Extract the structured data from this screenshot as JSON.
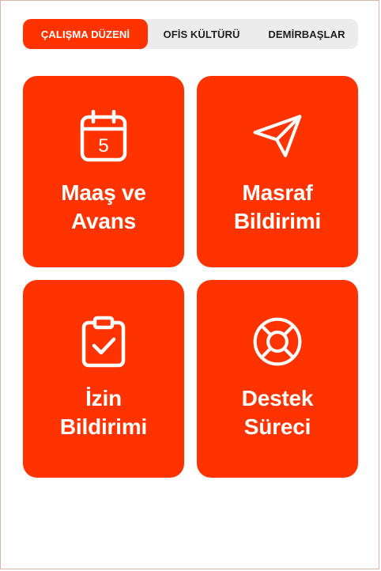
{
  "tabs": [
    {
      "label": "ÇALIŞMA DÜZENİ",
      "active": true
    },
    {
      "label": "OFİS KÜLTÜRÜ",
      "active": false
    },
    {
      "label": "DEMİRBAŞLAR",
      "active": false
    }
  ],
  "cards": [
    {
      "line1": "Maaş ve",
      "line2": "Avans",
      "icon": "calendar-icon",
      "calendar_day": "5"
    },
    {
      "line1": "Masraf",
      "line2": "Bildirimi",
      "icon": "send-icon"
    },
    {
      "line1": "İzin",
      "line2": "Bildirimi",
      "icon": "clipboard-check-icon"
    },
    {
      "line1": "Destek",
      "line2": "Süreci",
      "icon": "lifebuoy-icon"
    }
  ],
  "colors": {
    "accent": "#ff3300",
    "segment_bg": "#ececec",
    "text_dark": "#1f1f1f",
    "text_light": "#ffffff"
  }
}
